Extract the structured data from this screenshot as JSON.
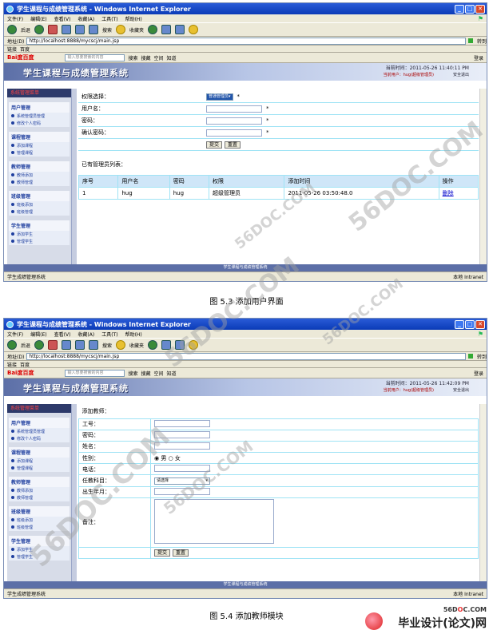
{
  "browser": {
    "title": "学生课程与成绩管理系统 - Windows Internet Explorer",
    "menu": [
      "文件(F)",
      "编辑(E)",
      "查看(V)",
      "收藏(A)",
      "工具(T)",
      "帮助(H)"
    ],
    "toolbar": {
      "back": "后退",
      "search": "搜索",
      "favorites": "收藏夹"
    },
    "address_label": "地址(D)",
    "go": "转到",
    "links_label": "链接",
    "links_item": "百度",
    "baidu_logo": "Bai度百度",
    "baidu_placeholder": "输入想要搜索的内容",
    "baidu_items": [
      "搜索",
      "搜藏",
      "空间",
      "知道",
      "登录"
    ],
    "status_left": "学生成绩管理系统",
    "status_zone": "本地 Intranet"
  },
  "app": {
    "system_title": "学生课程与成绩管理系统",
    "current_user": "当前用户：hug(超级管理员)",
    "logout": "安全退出",
    "footer": "学生课程与成绩管理系统",
    "nav_head": "系统管理菜单",
    "groups": [
      {
        "title": "用户管理",
        "items": [
          "系统管理员管理",
          "修改个人密码"
        ]
      },
      {
        "title": "课程管理",
        "items": [
          "添加课程",
          "管理课程"
        ]
      },
      {
        "title": "教师管理",
        "items": [
          "教师添加",
          "教师管理"
        ]
      },
      {
        "title": "班级管理",
        "items": [
          "班级添加",
          "班级管理"
        ]
      },
      {
        "title": "学生管理",
        "items": [
          "添加学生",
          "管理学生"
        ]
      }
    ]
  },
  "shot1": {
    "url": "http://localhost:8888/mycscj/main.jsp",
    "time": "当前时间：2011-05-26 11:40:11 PM",
    "form": {
      "role_label": "权限选择：",
      "role_value": "普通管理员",
      "username_label": "用户名：",
      "password_label": "密码：",
      "confirm_label": "确认密码：",
      "star": "*",
      "submit": "提交",
      "reset": "重置"
    },
    "list_title": "已有管理员列表：",
    "table": {
      "headers": [
        "序号",
        "用户名",
        "密码",
        "权限",
        "添加时间",
        "操作"
      ],
      "rows": [
        [
          "1",
          "hug",
          "hug",
          "超级管理员",
          "2011-05-26 03:50:48.0",
          "删除"
        ]
      ]
    }
  },
  "shot2": {
    "url": "http://localhost:8888/mycscj/main.jsp",
    "time": "当前时间：2011-05-26 11:42:09 PM",
    "form_title": "添加教师：",
    "fields": {
      "id": "工号：",
      "password": "密码：",
      "name": "姓名：",
      "gender": "性别：",
      "male": "男",
      "female": "女",
      "phone": "电话：",
      "course": "任教科目：",
      "course_value": "请选择",
      "birth": "出生年月：",
      "note": "备注："
    },
    "submit": "提交",
    "reset": "重置"
  },
  "captions": {
    "fig1": "图 5.3   添加用户界面",
    "fig2": "图 5.4   添加教师模块"
  },
  "watermark": "56DOC.COM",
  "brand": {
    "site_a": "56D",
    "site_o": "O",
    "site_b": "C.COM",
    "title": "毕业设计(论文)网"
  }
}
